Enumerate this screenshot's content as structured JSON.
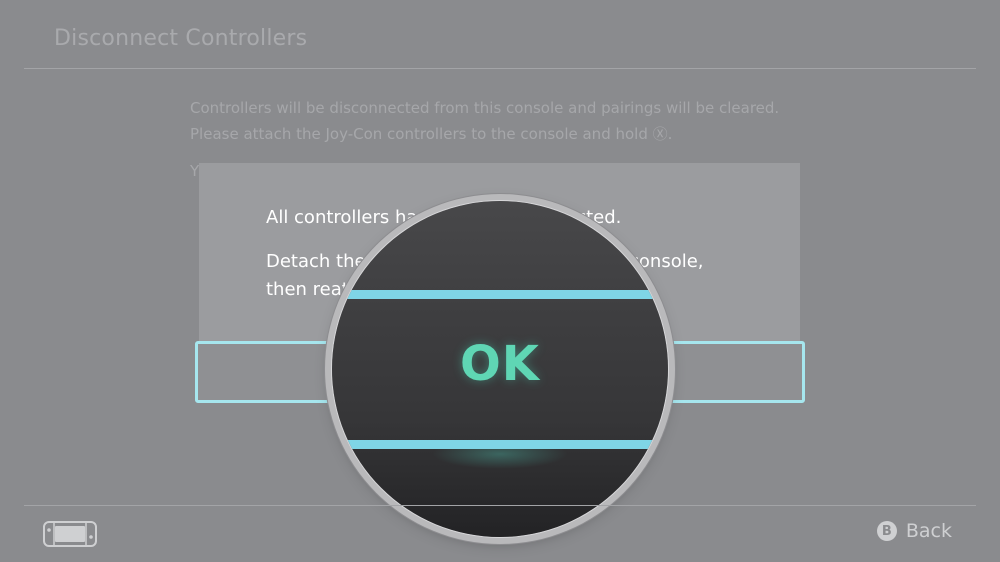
{
  "header": {
    "title": "Disconnect Controllers"
  },
  "instructions": {
    "line1": "Controllers will be disconnected from this console and pairings will be cleared.",
    "line2": "Please attach the Joy-Con controllers to the console and hold Ⓧ.",
    "partial_start": "Y"
  },
  "dialog": {
    "message_line1": "All controllers have been disconnected.",
    "message_line2": "Detach the Joy-Con controllers from the console,",
    "message_line3": "then reattach them.",
    "ok_label": "OK"
  },
  "footer": {
    "console_icon": "handheld-console-icon",
    "back_icon": "b-button-icon",
    "back_icon_glyph": "B",
    "back_label": "Back"
  },
  "colors": {
    "background": "#8a8b8e",
    "accent": "#a6e6ee",
    "ok_text": "#5fd6b4"
  }
}
